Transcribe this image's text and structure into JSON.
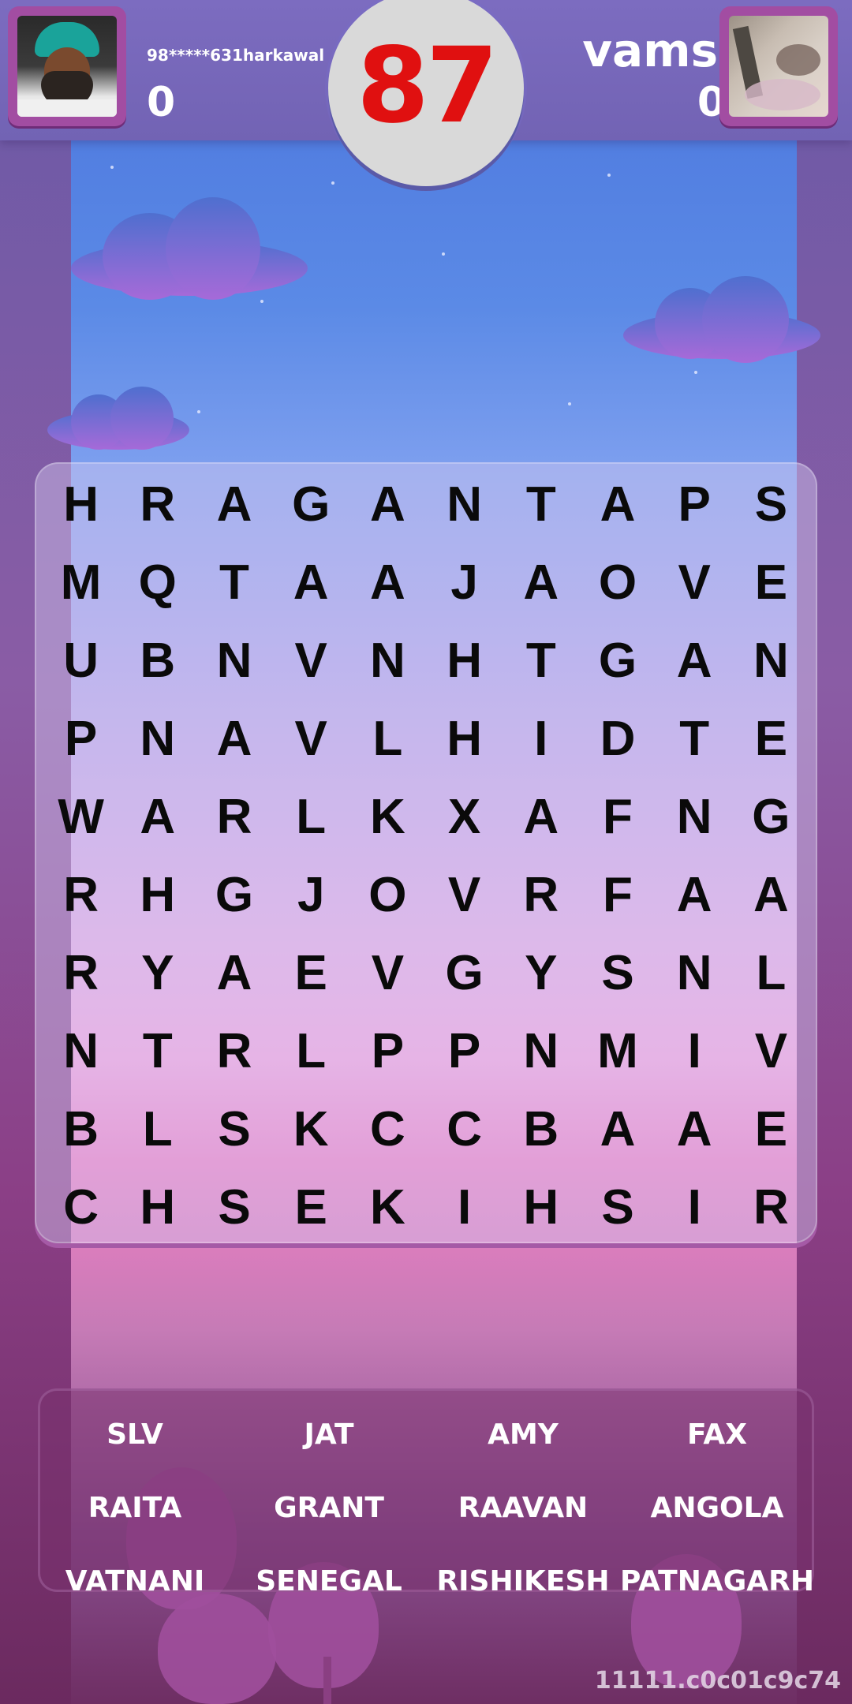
{
  "player1": {
    "name": "98*****631harkawal",
    "score": "0",
    "avatar": "profile-photo"
  },
  "player2": {
    "name": "vamsi",
    "score": "0",
    "avatar": "profile-photo"
  },
  "timer": "87",
  "grid": [
    [
      "H",
      "R",
      "A",
      "G",
      "A",
      "N",
      "T",
      "A",
      "P",
      "S"
    ],
    [
      "M",
      "Q",
      "T",
      "A",
      "A",
      "J",
      "A",
      "O",
      "V",
      "E"
    ],
    [
      "U",
      "B",
      "N",
      "V",
      "N",
      "H",
      "T",
      "G",
      "A",
      "N"
    ],
    [
      "P",
      "N",
      "A",
      "V",
      "L",
      "H",
      "I",
      "D",
      "T",
      "E"
    ],
    [
      "W",
      "A",
      "R",
      "L",
      "K",
      "X",
      "A",
      "F",
      "N",
      "G"
    ],
    [
      "R",
      "H",
      "G",
      "J",
      "O",
      "V",
      "R",
      "F",
      "A",
      "A"
    ],
    [
      "R",
      "Y",
      "A",
      "E",
      "V",
      "G",
      "Y",
      "S",
      "N",
      "L"
    ],
    [
      "N",
      "T",
      "R",
      "L",
      "P",
      "P",
      "N",
      "M",
      "I",
      "V"
    ],
    [
      "B",
      "L",
      "S",
      "K",
      "C",
      "C",
      "B",
      "A",
      "A",
      "E"
    ],
    [
      "C",
      "H",
      "S",
      "E",
      "K",
      "I",
      "H",
      "S",
      "I",
      "R"
    ]
  ],
  "words": [
    "SLV",
    "JAT",
    "AMY",
    "FAX",
    "RAITA",
    "GRANT",
    "RAAVAN",
    "ANGOLA",
    "VATNANI",
    "SENEGAL",
    "RISHIKESH",
    "PATNAGARH"
  ],
  "footer_id": "11111.c0c01c9c74",
  "colors": {
    "timer_text": "#e01010",
    "avatar_frame": "#a24da2",
    "topbar": "#7568b8"
  }
}
